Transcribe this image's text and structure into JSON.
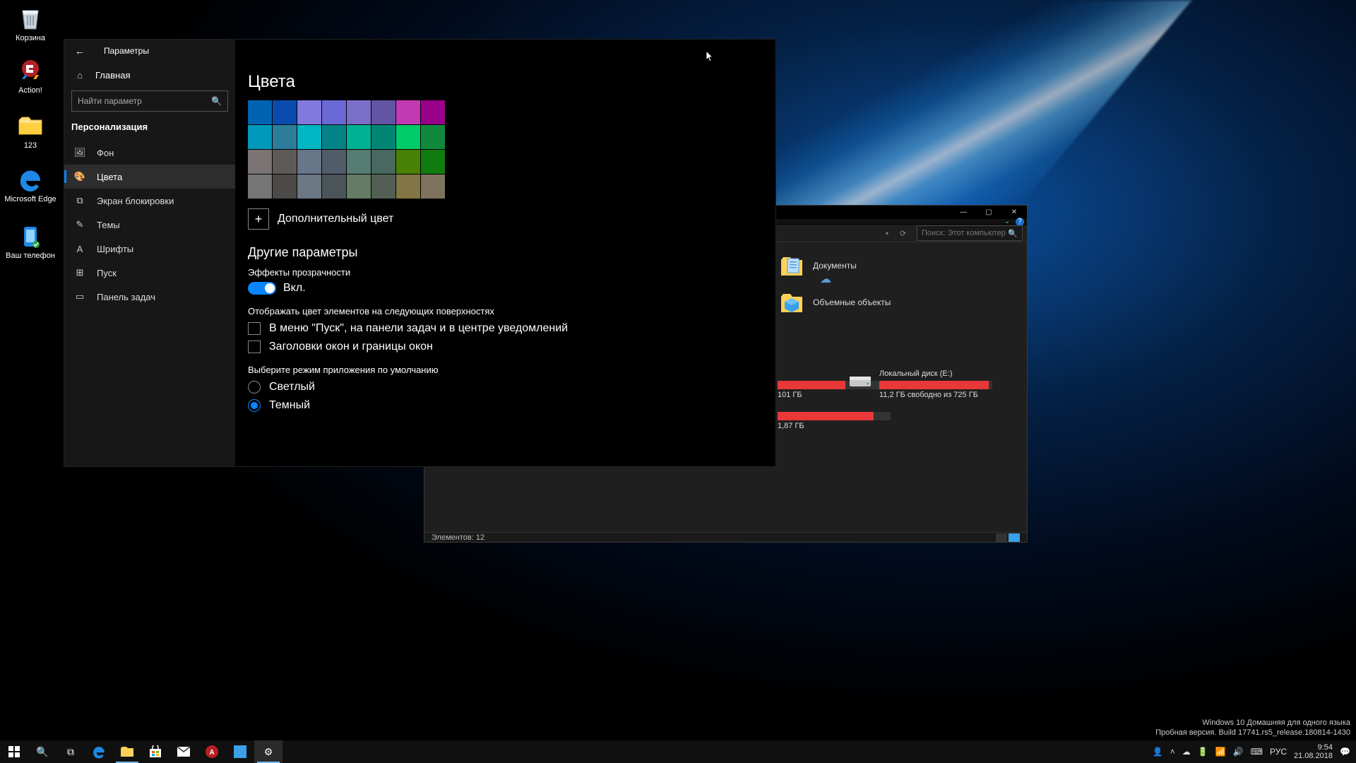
{
  "desktop": {
    "icons": [
      {
        "label": "Корзина",
        "icon": "recycle"
      },
      {
        "label": "Action!",
        "icon": "action"
      },
      {
        "label": "123",
        "icon": "folder"
      },
      {
        "label": "Microsoft Edge",
        "icon": "edge"
      },
      {
        "label": "Ваш телефон",
        "icon": "phone"
      }
    ]
  },
  "explorer": {
    "search_placeholder": "Поиск: Этот компьютер",
    "status_items": "Элементов: 12",
    "folders": [
      {
        "label": "Документы",
        "icon": "doc"
      },
      {
        "label": "Объемные объекты",
        "icon": "3d"
      }
    ],
    "drives": [
      {
        "label": "",
        "free": "101 ГБ",
        "fill": 60
      },
      {
        "label": "",
        "free": "1,87 ГБ",
        "fill": 85
      },
      {
        "label": "Локальный диск (E:)",
        "free": "11,2 ГБ свободно из 725 ГБ",
        "fill": 95
      }
    ]
  },
  "settings": {
    "app": "Параметры",
    "home": "Главная",
    "search_placeholder": "Найти параметр",
    "category": "Персонализация",
    "items": [
      {
        "label": "Фон"
      },
      {
        "label": "Цвета"
      },
      {
        "label": "Экран блокировки"
      },
      {
        "label": "Темы"
      },
      {
        "label": "Шрифты"
      },
      {
        "label": "Пуск"
      },
      {
        "label": "Панель задач"
      }
    ],
    "title": "Цвета",
    "colors": [
      "#0063b1",
      "#0a4cad",
      "#8378de",
      "#6b69d6",
      "#7c6fca",
      "#6455a2",
      "#c239b3",
      "#9a0089",
      "#0099bc",
      "#2d7d9a",
      "#00b7c3",
      "#038387",
      "#00b294",
      "#018574",
      "#00cc6a",
      "#10893e",
      "#7a7574",
      "#5d5a58",
      "#68768a",
      "#515c6b",
      "#567c73",
      "#486860",
      "#498205",
      "#107c10",
      "#767676",
      "#4c4a48",
      "#6b7884",
      "#4a5459",
      "#647c64",
      "#525e54",
      "#847545",
      "#7e735f"
    ],
    "custom_color": "Дополнительный цвет",
    "other_h": "Другие параметры",
    "transparency_label": "Эффекты прозрачности",
    "toggle_on": "Вкл.",
    "surfaces_label": "Отображать цвет элементов на следующих поверхностях",
    "check1": "В меню \"Пуск\", на панели задач и в центре уведомлений",
    "check2": "Заголовки окон и границы окон",
    "mode_label": "Выберите режим приложения по умолчанию",
    "mode_light": "Светлый",
    "mode_dark": "Темный"
  },
  "watermark": {
    "line1": "Windows 10 Домашняя для одного языка",
    "line2": "Пробная версия. Build 17741.rs5_release.180814-1430"
  },
  "tray": {
    "lang": "РУС",
    "time": "9:54",
    "date": "21.08.2018"
  }
}
